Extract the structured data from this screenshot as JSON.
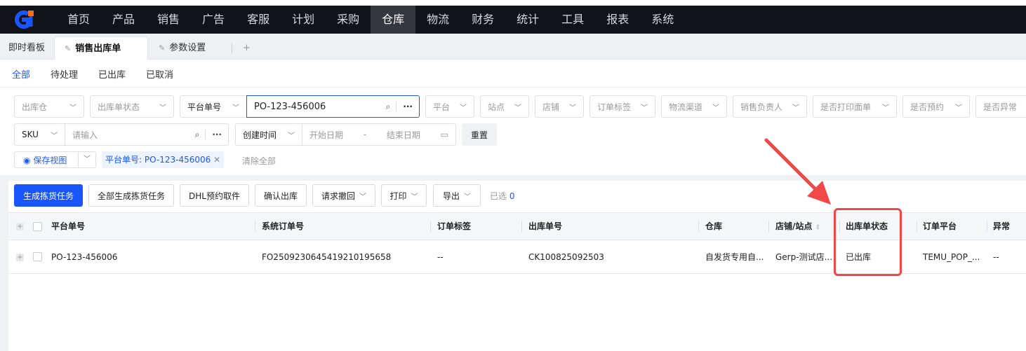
{
  "top_nav": {
    "items": [
      "首页",
      "产品",
      "销售",
      "广告",
      "客服",
      "计划",
      "采购",
      "仓库",
      "物流",
      "财务",
      "统计",
      "工具",
      "报表",
      "系统"
    ],
    "active": "仓库"
  },
  "page_tabs": {
    "dashboard": "即时看板",
    "sales_outbound": "销售出库单",
    "params": "参数设置",
    "add": "+"
  },
  "status_tabs": [
    "全部",
    "待处理",
    "已出库",
    "已取消"
  ],
  "filters": {
    "warehouse": "出库仓",
    "outbound_status": "出库单状态",
    "search_field": "平台单号",
    "search_value": "PO-123-456006",
    "platform": "平台",
    "site": "站点",
    "store": "店铺",
    "order_tag": "订单标签",
    "logistics": "物流渠道",
    "sales_owner": "销售负责人",
    "printed": "是否打印面单",
    "reserved": "是否预约",
    "abnormal": "是否异常",
    "sku_field": "SKU",
    "sku_placeholder": "请输入",
    "time_field": "创建时间",
    "start_date": "开始日期",
    "date_sep": "-",
    "end_date": "结束日期",
    "reset": "重置",
    "save_view": "保存视图",
    "active_tag": "平台单号: PO-123-456006",
    "clear_all": "清除全部"
  },
  "toolbar": {
    "gen_pick": "生成拣货任务",
    "gen_all_pick": "全部生成拣货任务",
    "dhl": "DHL预约取件",
    "confirm": "确认出库",
    "recall": "请求撤回",
    "print": "打印",
    "export": "导出",
    "selected_label": "已选",
    "selected_count": "0"
  },
  "table": {
    "headers": [
      "平台单号",
      "系统订单号",
      "订单标签",
      "出库单号",
      "仓库",
      "店铺/站点",
      "出库单状态",
      "订单平台",
      "异常"
    ],
    "rows": [
      [
        "PO-123-456006",
        "FO2509230645419210195658",
        "--",
        "CK100825092503",
        "自发货专用自...",
        "Gerp-测试店...",
        "已出库",
        "TEMU_POP_...",
        "--"
      ]
    ]
  },
  "colors": {
    "accent": "#1a56ff",
    "nav_bg": "#111318",
    "annotation": "#f04848"
  }
}
